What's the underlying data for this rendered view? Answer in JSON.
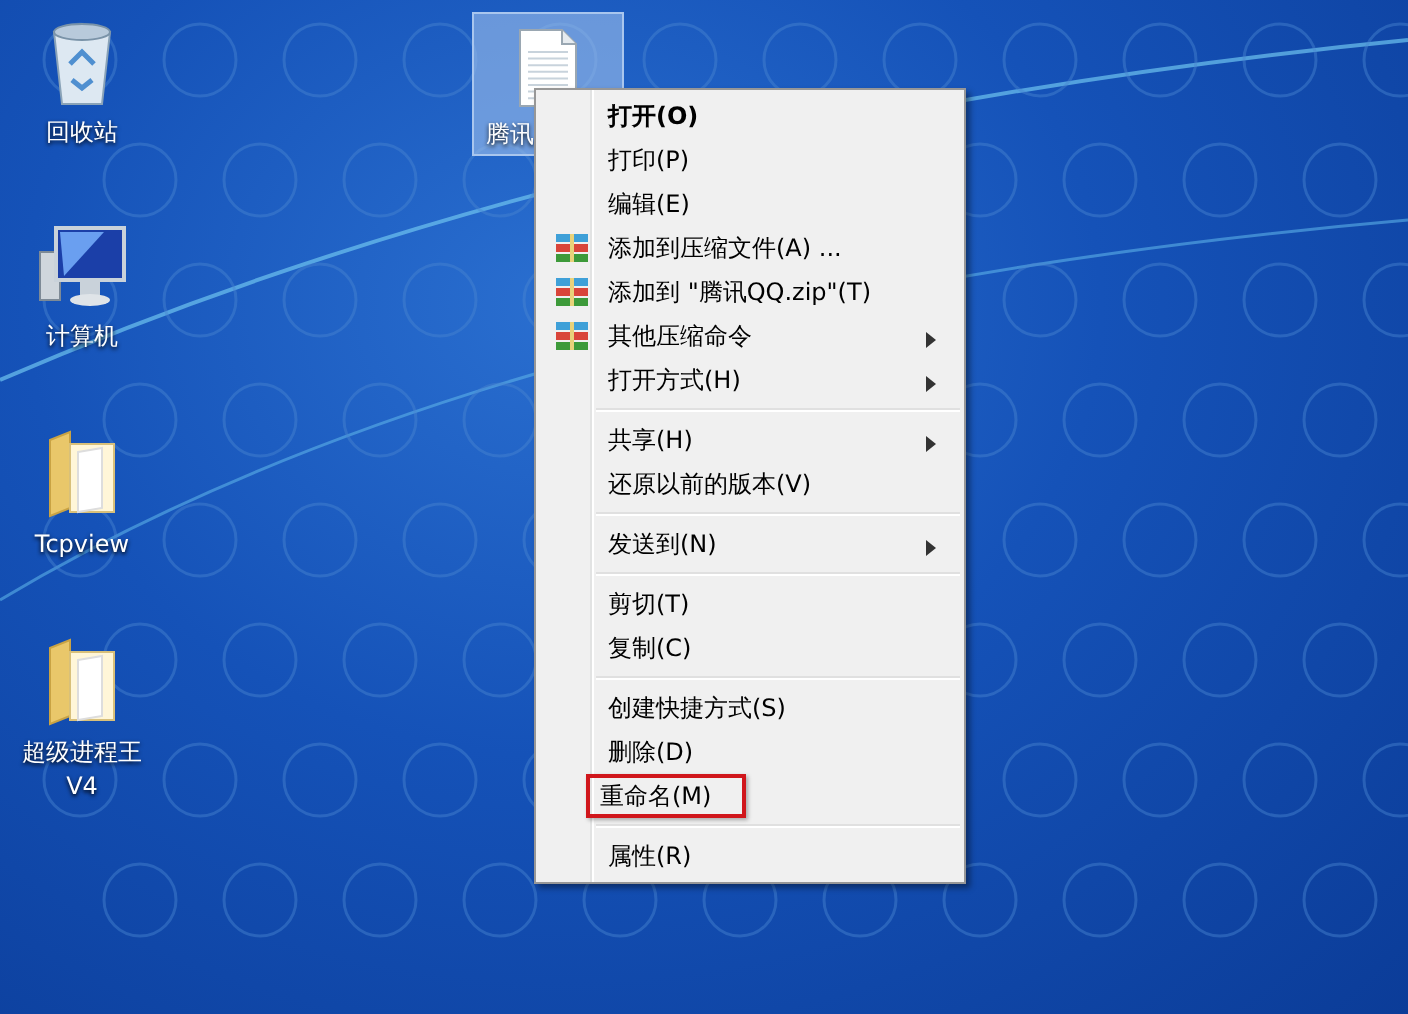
{
  "desktop_icons": [
    {
      "kind": "recycle-bin",
      "label": "回收站"
    },
    {
      "kind": "computer",
      "label": "计算机"
    },
    {
      "kind": "folder",
      "label": "Tcpview"
    },
    {
      "kind": "folder",
      "label": "超级进程王 V4"
    }
  ],
  "selected_file": {
    "label": "腾讯",
    "selected": true
  },
  "context_menu": {
    "groups": [
      [
        {
          "label": "打开(O)",
          "kind": "default",
          "highlighted": false
        },
        {
          "label": "打印(P)",
          "kind": "plain",
          "highlighted": false
        },
        {
          "label": "编辑(E)",
          "kind": "plain",
          "highlighted": false
        },
        {
          "label": "添加到压缩文件(A) ...",
          "kind": "archive",
          "highlighted": false
        },
        {
          "label": "添加到 \"腾讯QQ.zip\"(T)",
          "kind": "archive",
          "highlighted": false
        },
        {
          "label": "其他压缩命令",
          "kind": "archive-submenu",
          "highlighted": false
        },
        {
          "label": "打开方式(H)",
          "kind": "submenu",
          "highlighted": false
        }
      ],
      [
        {
          "label": "共享(H)",
          "kind": "submenu",
          "highlighted": false
        },
        {
          "label": "还原以前的版本(V)",
          "kind": "plain",
          "highlighted": false
        }
      ],
      [
        {
          "label": "发送到(N)",
          "kind": "submenu",
          "highlighted": false
        }
      ],
      [
        {
          "label": "剪切(T)",
          "kind": "plain",
          "highlighted": false
        },
        {
          "label": "复制(C)",
          "kind": "plain",
          "highlighted": false
        }
      ],
      [
        {
          "label": "创建快捷方式(S)",
          "kind": "plain",
          "highlighted": false
        },
        {
          "label": "删除(D)",
          "kind": "plain",
          "highlighted": false
        },
        {
          "label": "重命名(M)",
          "kind": "plain",
          "highlighted": true
        }
      ],
      [
        {
          "label": "属性(R)",
          "kind": "plain",
          "highlighted": false
        }
      ]
    ]
  }
}
